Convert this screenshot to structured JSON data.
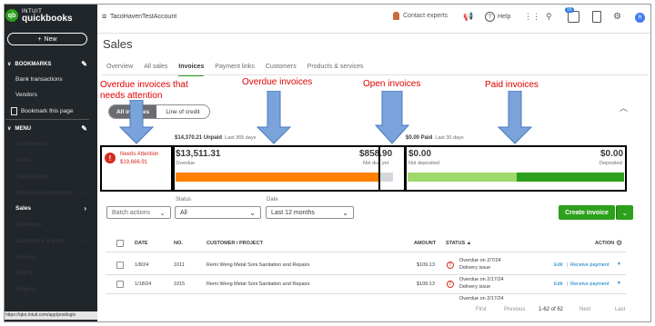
{
  "app": {
    "logo_small": "INTUIT",
    "logo_big": "quickbooks",
    "logo_badge": "qb",
    "new_label": "New"
  },
  "sidebar": {
    "bookmarks_label": "BOOKMARKS",
    "bookmark_items": [
      "Bank transactions",
      "Vendors",
      "Bookmark this page"
    ],
    "menu_label": "MENU",
    "menu_items": [
      "Dashboards",
      "Tasks",
      "Transactions",
      "Advanced accounting",
      "Sales",
      "Expenses",
      "Customers & leads",
      "Reports",
      "Payroll",
      "Projects"
    ],
    "active_item": "Sales",
    "status_url": "https://qbo.intuit.com/app/postlogin"
  },
  "topbar": {
    "company": "TacoHavenTestAccount",
    "contact_experts": "Contact experts",
    "help": "Help",
    "notification_count": "15",
    "avatar_letter": "R"
  },
  "page": {
    "title": "Sales",
    "tabs": [
      "Overview",
      "All sales",
      "Invoices",
      "Payment links",
      "Customers",
      "Products & services"
    ],
    "active_tab": "Invoices"
  },
  "annotations": {
    "overdue_attention": "Overdue invoices that needs attention",
    "overdue": "Overdue invoices",
    "open": "Open invoices",
    "paid": "Paid invoices"
  },
  "toggle": {
    "option1": "All invoices",
    "option2": "Line of credit"
  },
  "summary": {
    "unpaid_amount": "$14,370.21 Unpaid",
    "unpaid_period": "Last 365 days",
    "paid_amount": "$0.00 Paid",
    "paid_period": "Last 30 days",
    "overdue_value": "$13,511.31",
    "overdue_label": "Overdue",
    "not_due_value": "$858.90",
    "not_due_label": "Not due yet",
    "not_deposited_value": "$0.00",
    "not_deposited_label": "Not deposited",
    "deposited_value": "$0.00",
    "deposited_label": "Deposited",
    "needs_attention_title": "Needs Attention",
    "needs_attention_amount": "$19,666.91"
  },
  "filters": {
    "batch_label": "Batch actions",
    "status_label": "Status",
    "status_value": "All",
    "date_label": "Date",
    "date_value": "Last 12 months",
    "create_invoice": "Create invoice"
  },
  "table": {
    "headers": [
      "DATE",
      "NO.",
      "CUSTOMER / PROJECT",
      "AMOUNT",
      "STATUS ▲",
      "ACTION"
    ],
    "rows": [
      {
        "date": "1/8/24",
        "no": "1011",
        "customer": "Remi Weng Metal Soni Sanitation and Repairs",
        "amount": "$109.13",
        "status1": "Overdue on 2/7/24",
        "status2": "Delivery issue",
        "action1": "Edit",
        "action2": "Receive payment"
      },
      {
        "date": "1/18/24",
        "no": "1015",
        "customer": "Remi Weng Metal Soni Sanitation and Repairs",
        "amount": "$109.13",
        "status1": "Overdue on 2/17/24",
        "status2": "Delivery issue",
        "action1": "Edit",
        "action2": "Receive payment"
      },
      {
        "status1": "Overdue on 2/17/24"
      }
    ]
  },
  "pager": {
    "first": "First",
    "previous": "Previous",
    "range": "1-62 of 62",
    "next": "Next",
    "last": "Last"
  },
  "colors": {
    "overdue_bar": "#ff8000",
    "not_due_bar": "#d4d7dc",
    "not_deposited_bar": "#9fd86b",
    "deposited_bar": "#2ca01c",
    "annotation": "#e00000",
    "arrow": "#5b8fd6"
  }
}
